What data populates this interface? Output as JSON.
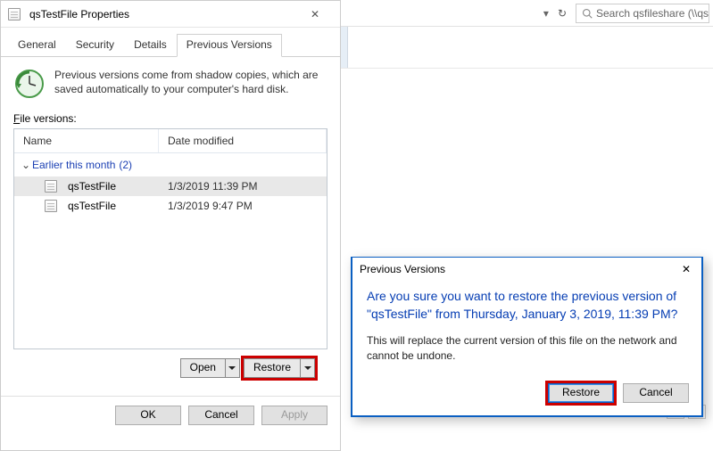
{
  "propertiesDialog": {
    "title": "qsTestFile Properties",
    "tabs": {
      "general": "General",
      "security": "Security",
      "details": "Details",
      "previous": "Previous Versions"
    },
    "infoText": "Previous versions come from shadow copies, which are saved automatically to your computer's hard disk.",
    "fileVersionsLabel": "File versions:",
    "fileVersionsAccessKey": "F",
    "columns": {
      "name": "Name",
      "date": "Date modified"
    },
    "group": {
      "label": "Earlier this month",
      "count": "(2)"
    },
    "rows": [
      {
        "name": "qsTestFile",
        "date": "1/3/2019 11:39 PM",
        "selected": true
      },
      {
        "name": "qsTestFile",
        "date": "1/3/2019 9:47 PM",
        "selected": false
      }
    ],
    "openLabel": "Open",
    "restoreLabel": "Restore",
    "ok": "OK",
    "cancel": "Cancel",
    "apply": "Apply"
  },
  "explorer": {
    "searchPlaceholder": "Search qsfileshare (\\\\qsstorag..."
  },
  "confirm": {
    "title": "Previous Versions",
    "headline": "Are you sure you want to restore the previous version of \"qsTestFile\" from Thursday, January 3, 2019, 11:39 PM?",
    "body": "This will replace the current version of this file on the network and cannot be undone.",
    "restore": "Restore",
    "cancel": "Cancel"
  }
}
